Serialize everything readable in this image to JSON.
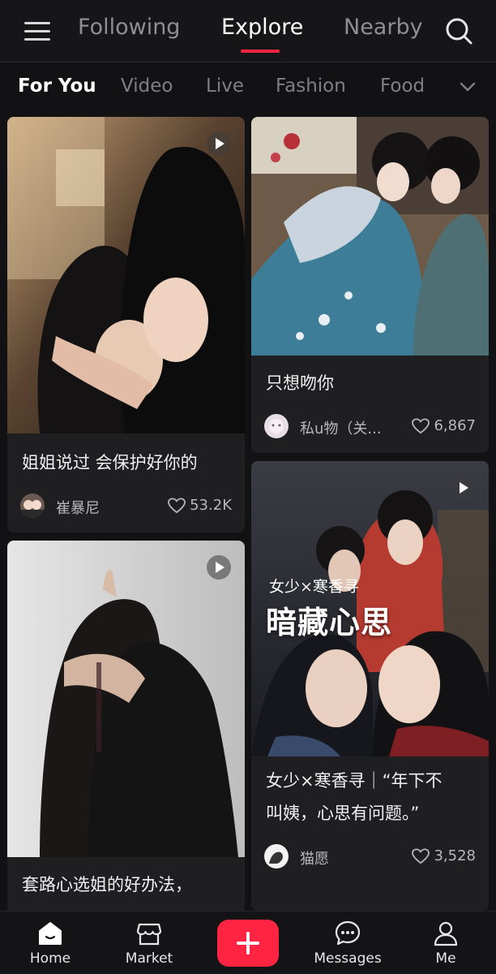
{
  "header": {
    "tabs": [
      "Following",
      "Explore",
      "Nearby"
    ],
    "active_tab": "Explore"
  },
  "categories": {
    "items": [
      "For You",
      "Video",
      "Live",
      "Fashion",
      "Food"
    ],
    "active": "For You"
  },
  "feed": {
    "left": [
      {
        "title": "姐姐说过 会保护好你的",
        "author": "崔暴尼",
        "likes": "53.2K",
        "video": true
      },
      {
        "title": "套路心选姐的好办法，",
        "video": true
      }
    ],
    "right": [
      {
        "title": "只想吻你",
        "author": "私u物（关...",
        "likes": "6,867",
        "video": false
      },
      {
        "title_line1": "女少×寒香寻｜“年下不",
        "title_line2": "叫姨，心思有问题。”",
        "author": "猫愿",
        "likes": "3,528",
        "video": true,
        "overlay_small": "女少×寒香寻",
        "overlay_big": "暗藏心思"
      }
    ]
  },
  "bottom_nav": {
    "home": "Home",
    "market": "Market",
    "messages": "Messages",
    "me": "Me"
  },
  "colors": {
    "accent": "#ff2442",
    "background": "#121214",
    "card": "#1f1f22"
  }
}
